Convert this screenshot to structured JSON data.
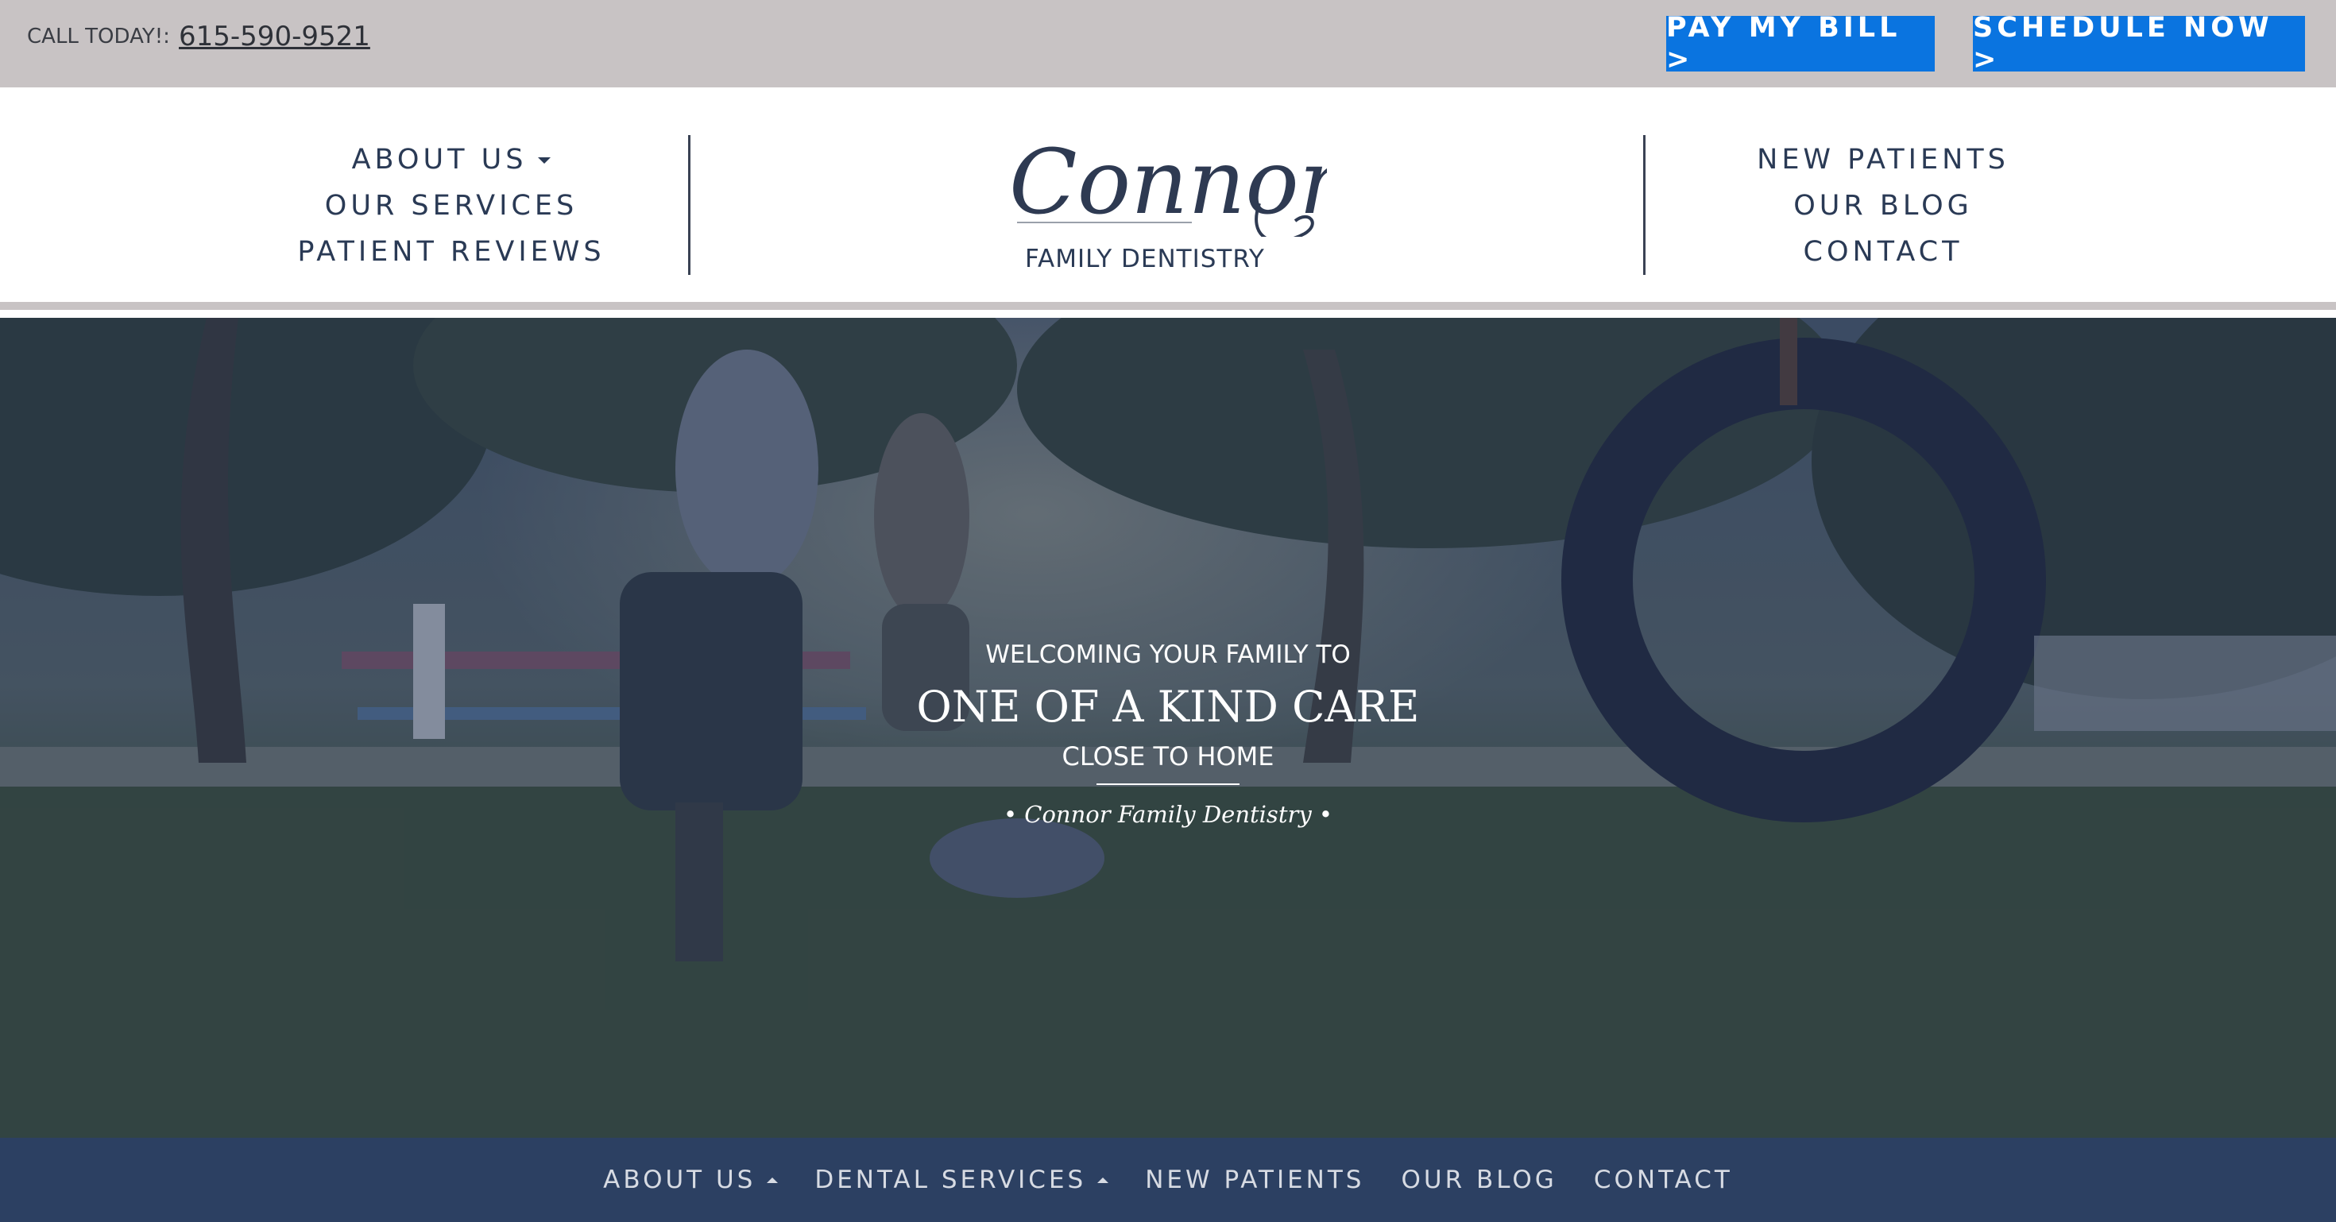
{
  "topbar": {
    "call_label": "CALL TODAY!:",
    "phone": "615-590-9521",
    "pay_button": "PAY MY BILL  >",
    "schedule_button": "SCHEDULE NOW  >",
    "button_color": "#0a74e0"
  },
  "header": {
    "left_nav": [
      "ABOUT US",
      "OUR SERVICES",
      "PATIENT REVIEWS"
    ],
    "right_nav": [
      "NEW PATIENTS",
      "OUR BLOG",
      "CONTACT"
    ],
    "logo_script": "Connor",
    "logo_subtitle": "FAMILY DENTISTRY"
  },
  "hero": {
    "line1": "WELCOMING YOUR FAMILY TO",
    "line2": "ONE OF A KIND CARE",
    "line3": "CLOSE TO HOME",
    "line4": "• Connor Family Dentistry •"
  },
  "bottom_nav": [
    "ABOUT US",
    "DENTAL SERVICES",
    "NEW PATIENTS",
    "OUR BLOG",
    "CONTACT"
  ],
  "colors": {
    "topbar_bg": "#c8c3c4",
    "navy": "#2a3a55",
    "bottom_nav_bg": "#2c4062"
  }
}
